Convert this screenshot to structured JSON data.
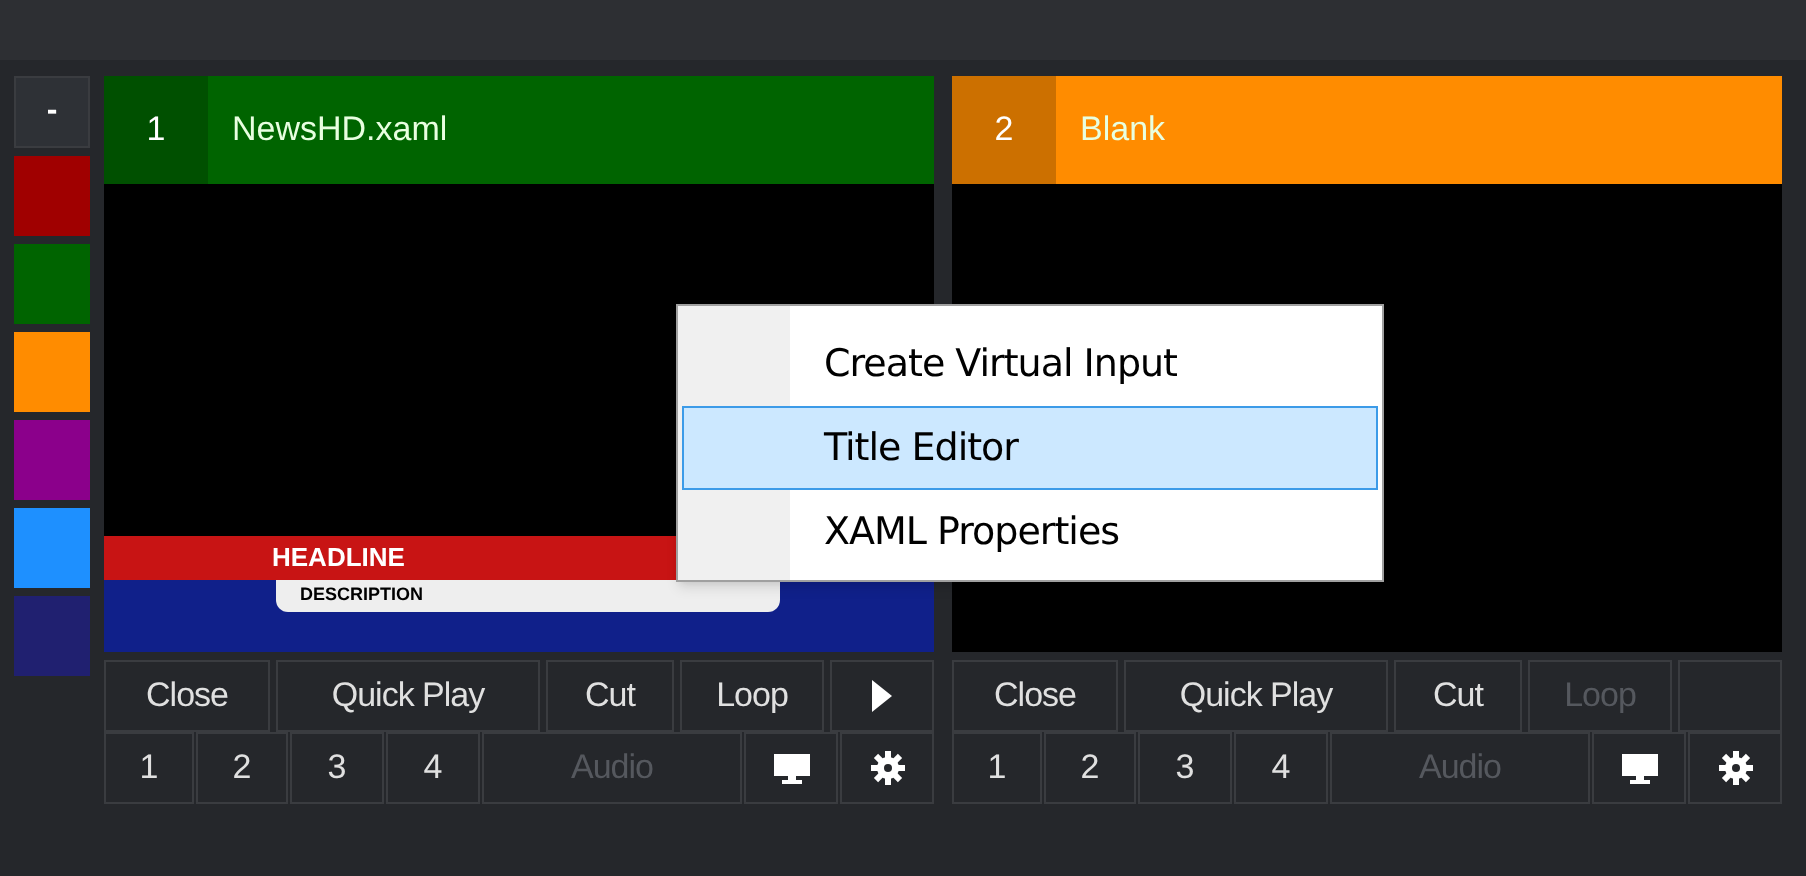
{
  "sidebar": {
    "collapse_button": "-",
    "swatches": [
      {
        "color": "#a00000"
      },
      {
        "color": "#006400"
      },
      {
        "color": "#ff8c00"
      },
      {
        "color": "#8b008b"
      },
      {
        "color": "#1e90ff"
      },
      {
        "color": "#202070"
      }
    ]
  },
  "inputs": [
    {
      "number": "1",
      "title": "NewsHD.xaml",
      "color": "#006400",
      "preview": {
        "kind": "lower_third",
        "headline": "HEADLINE",
        "description": "DESCRIPTION"
      },
      "controls": [
        {
          "label": "Close",
          "disabled": false
        },
        {
          "label": "Quick Play",
          "disabled": false
        },
        {
          "label": "Cut",
          "disabled": false
        },
        {
          "label": "Loop",
          "disabled": false
        }
      ],
      "play_button": true,
      "overlay_buttons": [
        "1",
        "2",
        "3",
        "4"
      ],
      "audio": {
        "label": "Audio",
        "disabled": true
      }
    },
    {
      "number": "2",
      "title": "Blank",
      "color": "#ff8c00",
      "preview": {
        "kind": "blank"
      },
      "controls": [
        {
          "label": "Close",
          "disabled": false
        },
        {
          "label": "Quick Play",
          "disabled": false
        },
        {
          "label": "Cut",
          "disabled": false
        },
        {
          "label": "Loop",
          "disabled": true
        }
      ],
      "play_button": false,
      "overlay_buttons": [
        "1",
        "2",
        "3",
        "4"
      ],
      "audio": {
        "label": "Audio",
        "disabled": true
      }
    }
  ],
  "context_menu": {
    "items": [
      {
        "label": "Create Virtual Input",
        "selected": false
      },
      {
        "label": "Title Editor",
        "selected": true
      },
      {
        "label": "XAML Properties",
        "selected": false
      }
    ]
  }
}
